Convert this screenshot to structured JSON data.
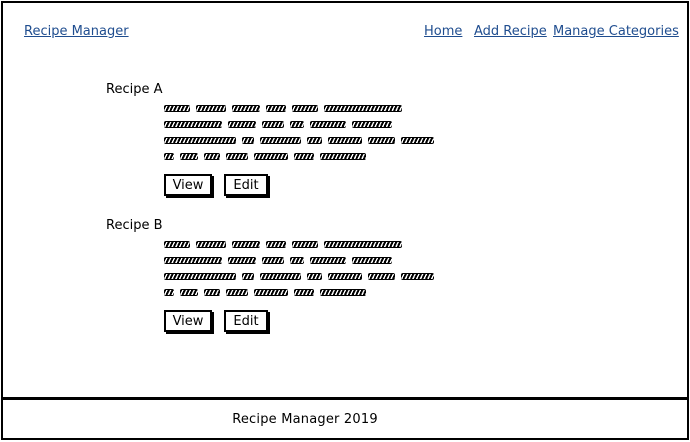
{
  "header": {
    "brand": "Recipe Manager",
    "nav": [
      {
        "label": "Home"
      },
      {
        "label": "Add Recipe"
      },
      {
        "label": "Manage Categories"
      }
    ]
  },
  "recipes": [
    {
      "title": "Recipe A",
      "view_label": "View",
      "edit_label": "Edit"
    },
    {
      "title": "Recipe B",
      "view_label": "View",
      "edit_label": "Edit"
    }
  ],
  "footer": {
    "text": "Recipe Manager 2019"
  }
}
